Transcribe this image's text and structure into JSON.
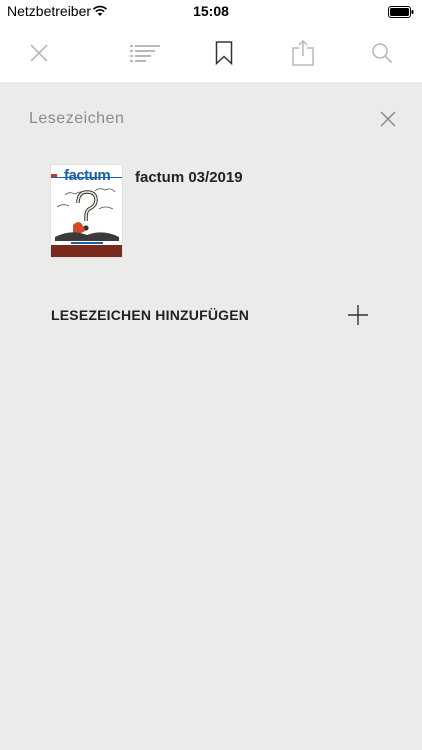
{
  "status_bar": {
    "carrier": "Netzbetreiber",
    "time": "15:08",
    "wifi_icon": "wifi-icon",
    "battery_icon": "battery-icon"
  },
  "toolbar": {
    "items": [
      {
        "icon": "close-icon"
      },
      {
        "icon": "table-of-contents-icon"
      },
      {
        "icon": "bookmark-icon",
        "active": true
      },
      {
        "icon": "share-icon"
      },
      {
        "icon": "search-icon"
      }
    ]
  },
  "panel": {
    "title": "Lesezeichen",
    "close_icon": "close-icon"
  },
  "bookmarks": [
    {
      "title": "factum 03/2019",
      "cover_logo": "factum"
    }
  ],
  "add_bookmark": {
    "label": "LESEZEICHEN HINZUFÜGEN",
    "icon": "plus-icon"
  },
  "colors": {
    "background": "#ebebea",
    "toolbar": "#ffffff",
    "icon_inactive": "#b9b9b9",
    "icon_active": "#333333",
    "cover_accent": "#7a2a1c",
    "logo_blue": "#1b5ea8"
  }
}
